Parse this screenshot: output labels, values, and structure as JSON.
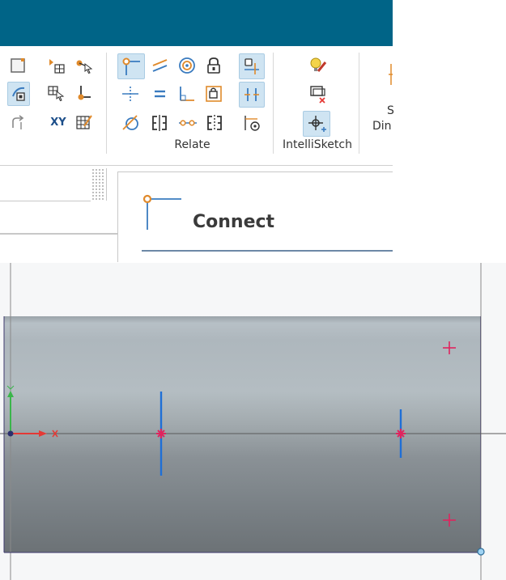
{
  "ribbon": {
    "relate_label": "Relate",
    "intellisketch_label": "IntelliSketch",
    "xy_text": "XY",
    "clipped_line1": "S",
    "clipped_line2": "Din"
  },
  "panel": {
    "title": "Connect"
  },
  "icons": [
    "square-tool-icon",
    "point-grid-icon",
    "select-point-icon",
    "wrap-tool-icon",
    "grid-select-icon",
    "point-connect-icon",
    "undo-relate-icon",
    "xy-icon",
    "table-icon",
    "connect-relation-icon",
    "parallel-icon",
    "concentric-icon",
    "lock-icon",
    "midpoint-icon",
    "equal-icon",
    "perpendicular-icon",
    "lock-set-icon",
    "tangent-icon",
    "symmetric-icon",
    "collinear-icon",
    "symmetric-2-icon",
    "relation-handle-icon",
    "maintain-relations-icon",
    "dimension-handle-icon",
    "bulb-pencil-icon",
    "alignment-icon",
    "intellisketch-cursor-icon"
  ],
  "colors": {
    "title_band": "#006487",
    "highlight": "#cfe4f2",
    "origin_green": "#3ab54a",
    "origin_red": "#e53935",
    "accent_pink": "#e0245e",
    "line_blue": "#1f6fd6"
  }
}
